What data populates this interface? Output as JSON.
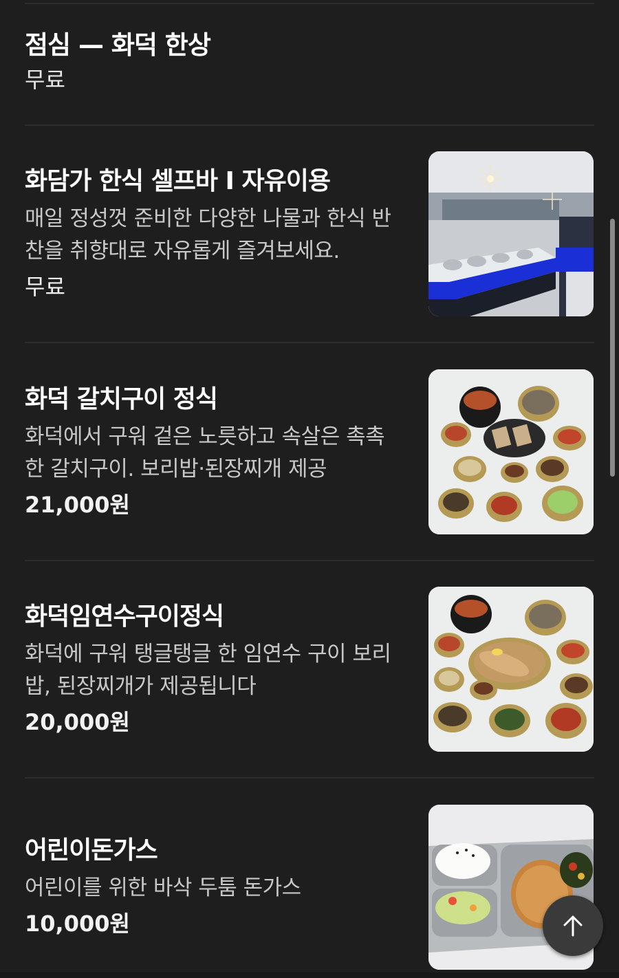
{
  "section": {
    "title": "점심 — 화덕 한상",
    "price": "무료"
  },
  "items": [
    {
      "name": "화담가 한식 셀프바 I 자유이용",
      "desc_lines": [
        "매일 정성껏 준비한 다양한 나물과 한식 반",
        "찬을 취향대로 자유롭게 즐겨보세요."
      ],
      "price": "무료",
      "image": "self-bar-photo"
    },
    {
      "name": "화덕 갈치구이 정식",
      "desc_lines": [
        "화덕에서 구워 겉은 노릇하고 속살은 촉촉",
        "한 갈치구이. 보리밥·된장찌개 제공"
      ],
      "price": "21,000원",
      "image": "galchi-set-photo"
    },
    {
      "name": "화덕임연수구이정식",
      "desc_lines": [
        "화덕에 구워 탱글탱글 한 임연수 구이 보리",
        "밥, 된장찌개가 제공됩니다"
      ],
      "price": "20,000원",
      "image": "imyeonsu-set-photo"
    },
    {
      "name": "어린이돈가스",
      "desc_lines": [
        "어린이를 위한 바삭 두툼 돈가스"
      ],
      "price": "10,000원",
      "image": "kids-donkatsu-photo"
    }
  ],
  "icons": {
    "scroll_top": "arrow-up-icon"
  },
  "colors": {
    "background": "#1e1e1e",
    "divider": "#2c2c2c",
    "text": "#ffffff",
    "desc_text": "#c8c8c8"
  }
}
